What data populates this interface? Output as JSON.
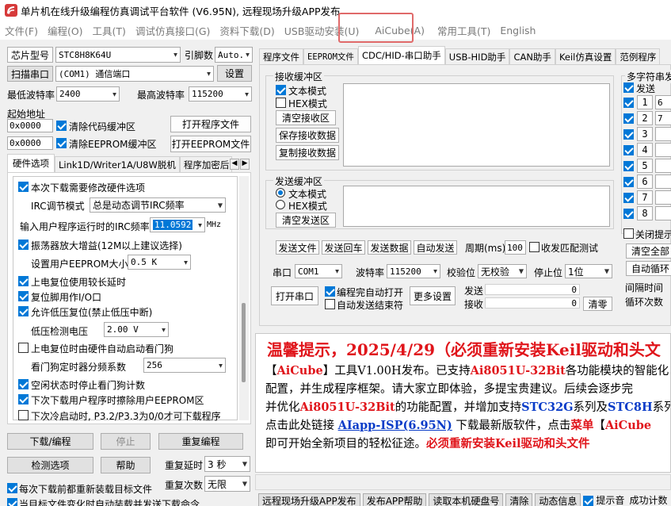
{
  "window": {
    "title": "单片机在线升级编程仿真调试平台软件 (V6.95N), 远程现场升级APP发布"
  },
  "colors": {
    "accent": "#0078d7",
    "notice_red": "#e0151b",
    "notice_blue": "#0a3cc8",
    "highlight": "#e06a6a"
  },
  "menu": [
    "文件(F)",
    "编程(O)",
    "工具(T)",
    "调试仿真接口(G)",
    "资料下载(D)",
    "USB驱动安装(U)",
    "AiCube(A)",
    "常用工具(T)",
    "English"
  ],
  "left": {
    "chip_btn": "芯片型号",
    "chip_value": "STC8H8K64U",
    "pins_label": "引脚数",
    "pins_value": "Auto.",
    "scan_btn": "扫描串口",
    "port_value": "(COM1) 通信端口",
    "settings_btn": "设置",
    "min_baud_label": "最低波特率",
    "min_baud": "2400",
    "max_baud_label": "最高波特率",
    "max_baud": "115200",
    "start_addr_label": "起始地址",
    "addr1": "0x0000",
    "clear_code": "清除代码缓冲区",
    "open_prog_btn": "打开程序文件",
    "addr2": "0x0000",
    "clear_eeprom": "清除EEPROM缓冲区",
    "open_eeprom_btn": "打开EEPROM文件",
    "tabs": [
      "硬件选项",
      "Link1D/Writer1A/U8W脱机",
      "程序加密后"
    ],
    "opts": {
      "o1": "本次下载需要修改硬件选项",
      "irc_mode_label": "IRC调节模式",
      "irc_mode": "总是动态调节IRC频率",
      "irc_freq_label": "输入用户程序运行时的IRC频率",
      "irc_freq": "11.0592",
      "mhz": "MHz",
      "o2": "振荡器放大增益(12M以上建议选择)",
      "eeprom_size_label": "设置用户EEPROM大小",
      "eeprom_size": "0.5 K",
      "o3": "上电复位使用较长延时",
      "o4": "复位脚用作I/O口",
      "o5": "允许低压复位(禁止低压中断)",
      "lv_label": "低压检测电压",
      "lv_value": "2.00 V",
      "o6": "上电复位时由硬件自动启动看门狗",
      "wdt_label": "看门狗定时器分频系数",
      "wdt_value": "256",
      "o7": "空闲状态时停止看门狗计数",
      "o8": "下次下载用户程序时擦除用户EEPROM区",
      "o9": "下次冷启动时, P3.2/P3.3为0/0才可下载程序"
    },
    "download_btn": "下载/编程",
    "stop_btn": "停止",
    "reprog_btn": "重复编程",
    "check_btn": "检测选项",
    "help_btn": "帮助",
    "delay_label": "重复延时",
    "delay_value": "3 秒",
    "reload_cb": "每次下载前都重新装载目标文件",
    "count_label": "重复次数",
    "count_value": "无限",
    "auto_send_cb": "当目标文件变化时自动装载并发送下载命令"
  },
  "right": {
    "tabs": [
      "程序文件",
      "EEPROM文件",
      "CDC/HID-串口助手",
      "USB-HID助手",
      "CAN助手",
      "Keil仿真设置",
      "范例程序"
    ],
    "recv_group": "接收缓冲区",
    "recv_text": "文本模式",
    "recv_hex": "HEX模式",
    "clear_recv": "清空接收区",
    "save_recv": "保存接收数据",
    "copy_recv": "复制接收数据",
    "send_group": "发送缓冲区",
    "send_text": "文本模式",
    "send_hex": "HEX模式",
    "clear_send": "清空发送区",
    "send_file": "发送文件",
    "send_back": "发送回车",
    "send_data": "发送数据",
    "auto_send": "自动发送",
    "period_label": "周期(ms)",
    "period_value": "100",
    "match_cb": "收发匹配测试",
    "port_label": "串口",
    "port_value": "COM1",
    "baud_label": "波特率",
    "baud_value": "115200",
    "parity_label": "校验位",
    "parity_value": "无校验",
    "stop_label": "停止位",
    "stop_value": "1位",
    "open_port_btn": "打开串口",
    "auto_open_cb": "编程完自动打开",
    "auto_close_cb": "自动发送结束符",
    "more_btn": "更多设置",
    "tx_label": "发送",
    "tx_value": "0",
    "rx_label": "接收",
    "rx_value": "0",
    "zero_btn": "清零",
    "multi_group": "多字符串发",
    "multi_send": "发送",
    "multi_rows": [
      "1",
      "2",
      "3",
      "4",
      "5",
      "6",
      "7",
      "8"
    ],
    "multi_vals": [
      "6",
      "7",
      "",
      "",
      "",
      "",
      "",
      ""
    ],
    "close_hint": "关闭提示",
    "clear_all": "清空全部",
    "auto_loop": "自动循环",
    "interval": "间隔时间",
    "loops": "循环次数"
  },
  "notice": {
    "headline": "温馨提示，2025/4/29（必须重新安装Keil驱动和头文",
    "l1a": "【",
    "l1b": "AiCube",
    "l1c": "】工具V1.00H发布。已支持",
    "l1d": "Ai8051U-32Bit",
    "l1e": "各功能模块的智能化",
    "l2": "配置，并生成程序框架。请大家立即体验，多提宝贵建议。后续会逐步完",
    "l3a": "并优化",
    "l3b": "Ai8051U-32Bit",
    "l3c": "的功能配置，并增加支持",
    "l3d": "STC32G",
    "l3e": "系列及",
    "l3f": "STC8H",
    "l3g": "系列",
    "l4a": "点击此处链接 ",
    "l4b": "AIapp-ISP(6.95N)",
    "l4c": " 下载最新版软件，点击",
    "l4d": "菜单",
    "l4e": "【",
    "l4f": "AiCube",
    "l5a": "即可开始全新项目的轻松征途。",
    "l5b": "必须重新安装Keil驱动和头文件"
  },
  "bottom": [
    "远程现场升级APP发布",
    "发布APP帮助",
    "读取本机硬盘号",
    "清除",
    "动态信息",
    "提示音",
    "成功计数"
  ]
}
